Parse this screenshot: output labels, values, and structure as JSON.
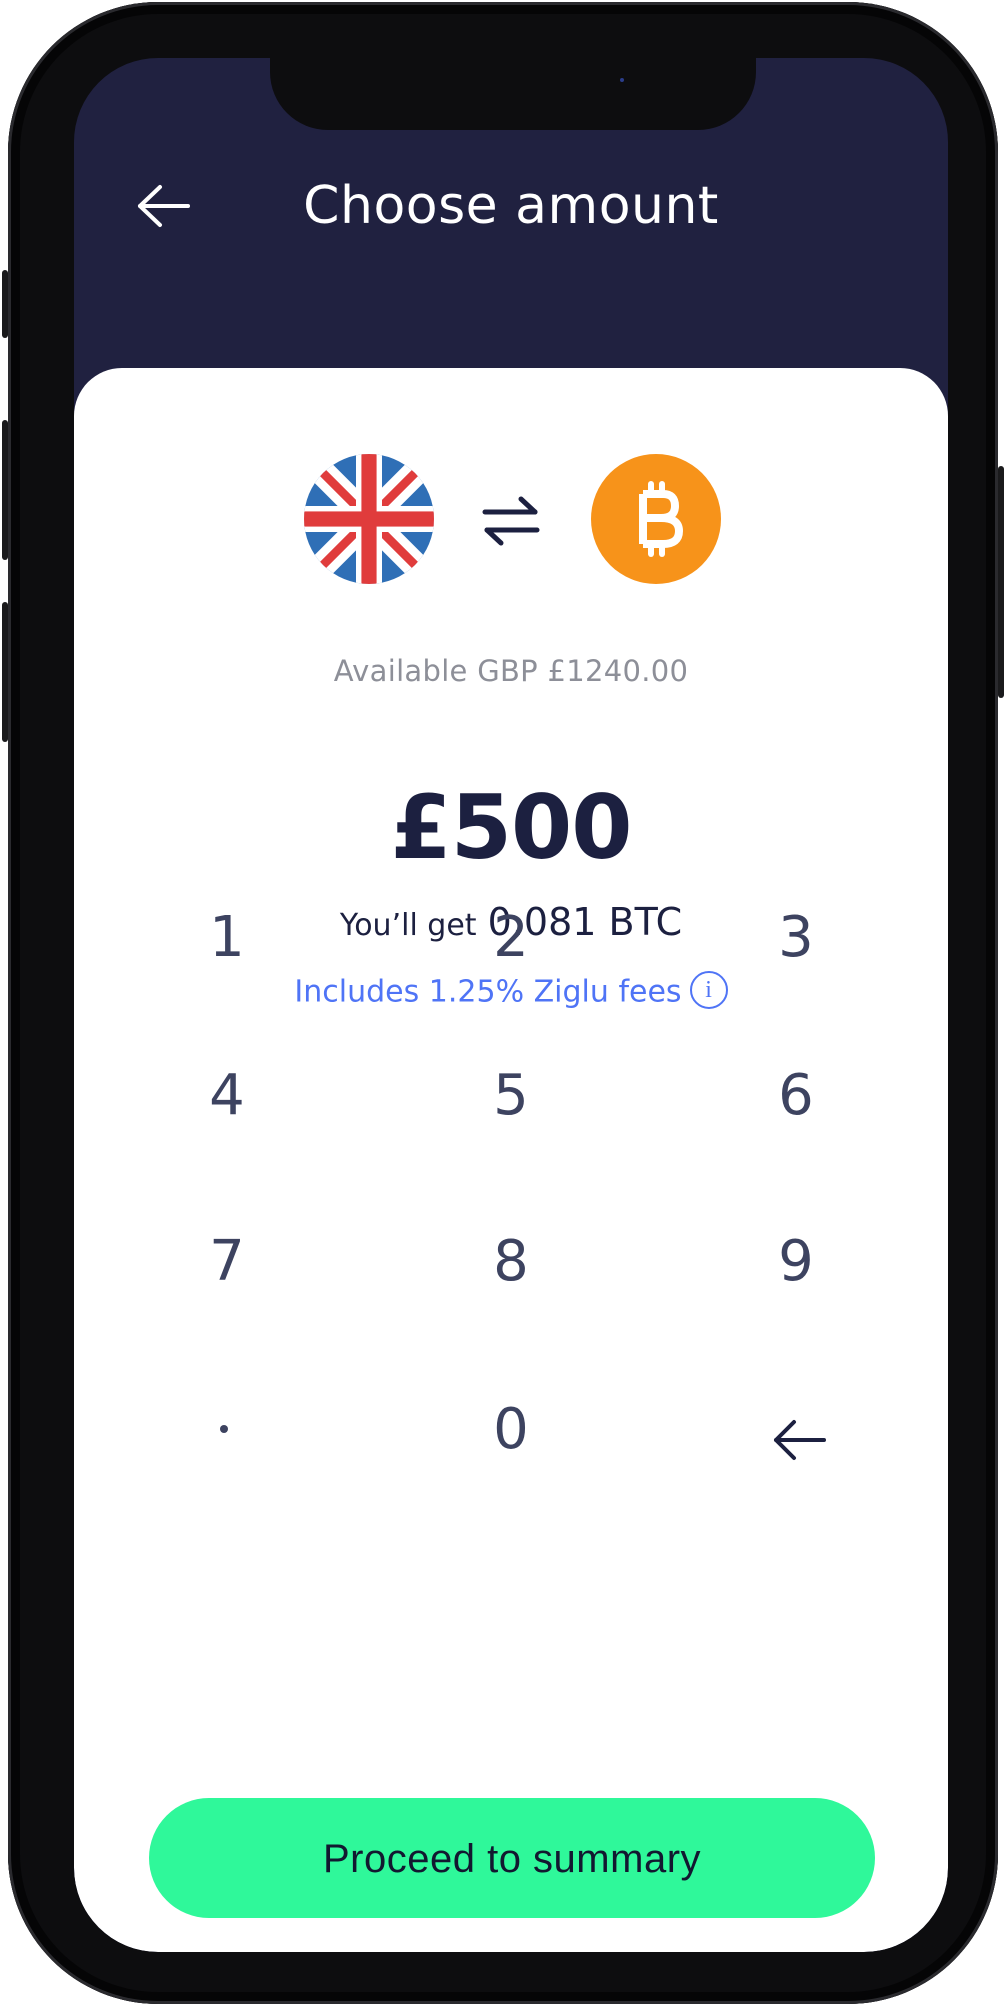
{
  "header": {
    "title": "Choose amount",
    "back_icon": "arrow-left-icon"
  },
  "conversion": {
    "from_icon": "uk-flag-icon",
    "swap_icon": "swap-arrows-icon",
    "to_icon": "bitcoin-icon",
    "available_text": "Available GBP £1240.00",
    "amount": "£500",
    "you_get_label": "You’ll get",
    "you_get_value": "0.081 BTC",
    "fees_text": "Includes 1.25% Ziglu fees",
    "info_icon": "info-icon",
    "info_glyph": "i"
  },
  "keypad": {
    "keys": [
      "1",
      "2",
      "3",
      "4",
      "5",
      "6",
      "7",
      "8",
      "9",
      "0"
    ],
    "decimal_key": "decimal-point",
    "backspace_icon": "backspace-arrow-icon"
  },
  "actions": {
    "proceed_label": "Proceed to summary"
  },
  "colors": {
    "header_bg": "#202140",
    "accent_button": "#2ff89a",
    "link_blue": "#4f74f6",
    "bitcoin_orange": "#f7931a",
    "text_dark": "#1c2040"
  }
}
